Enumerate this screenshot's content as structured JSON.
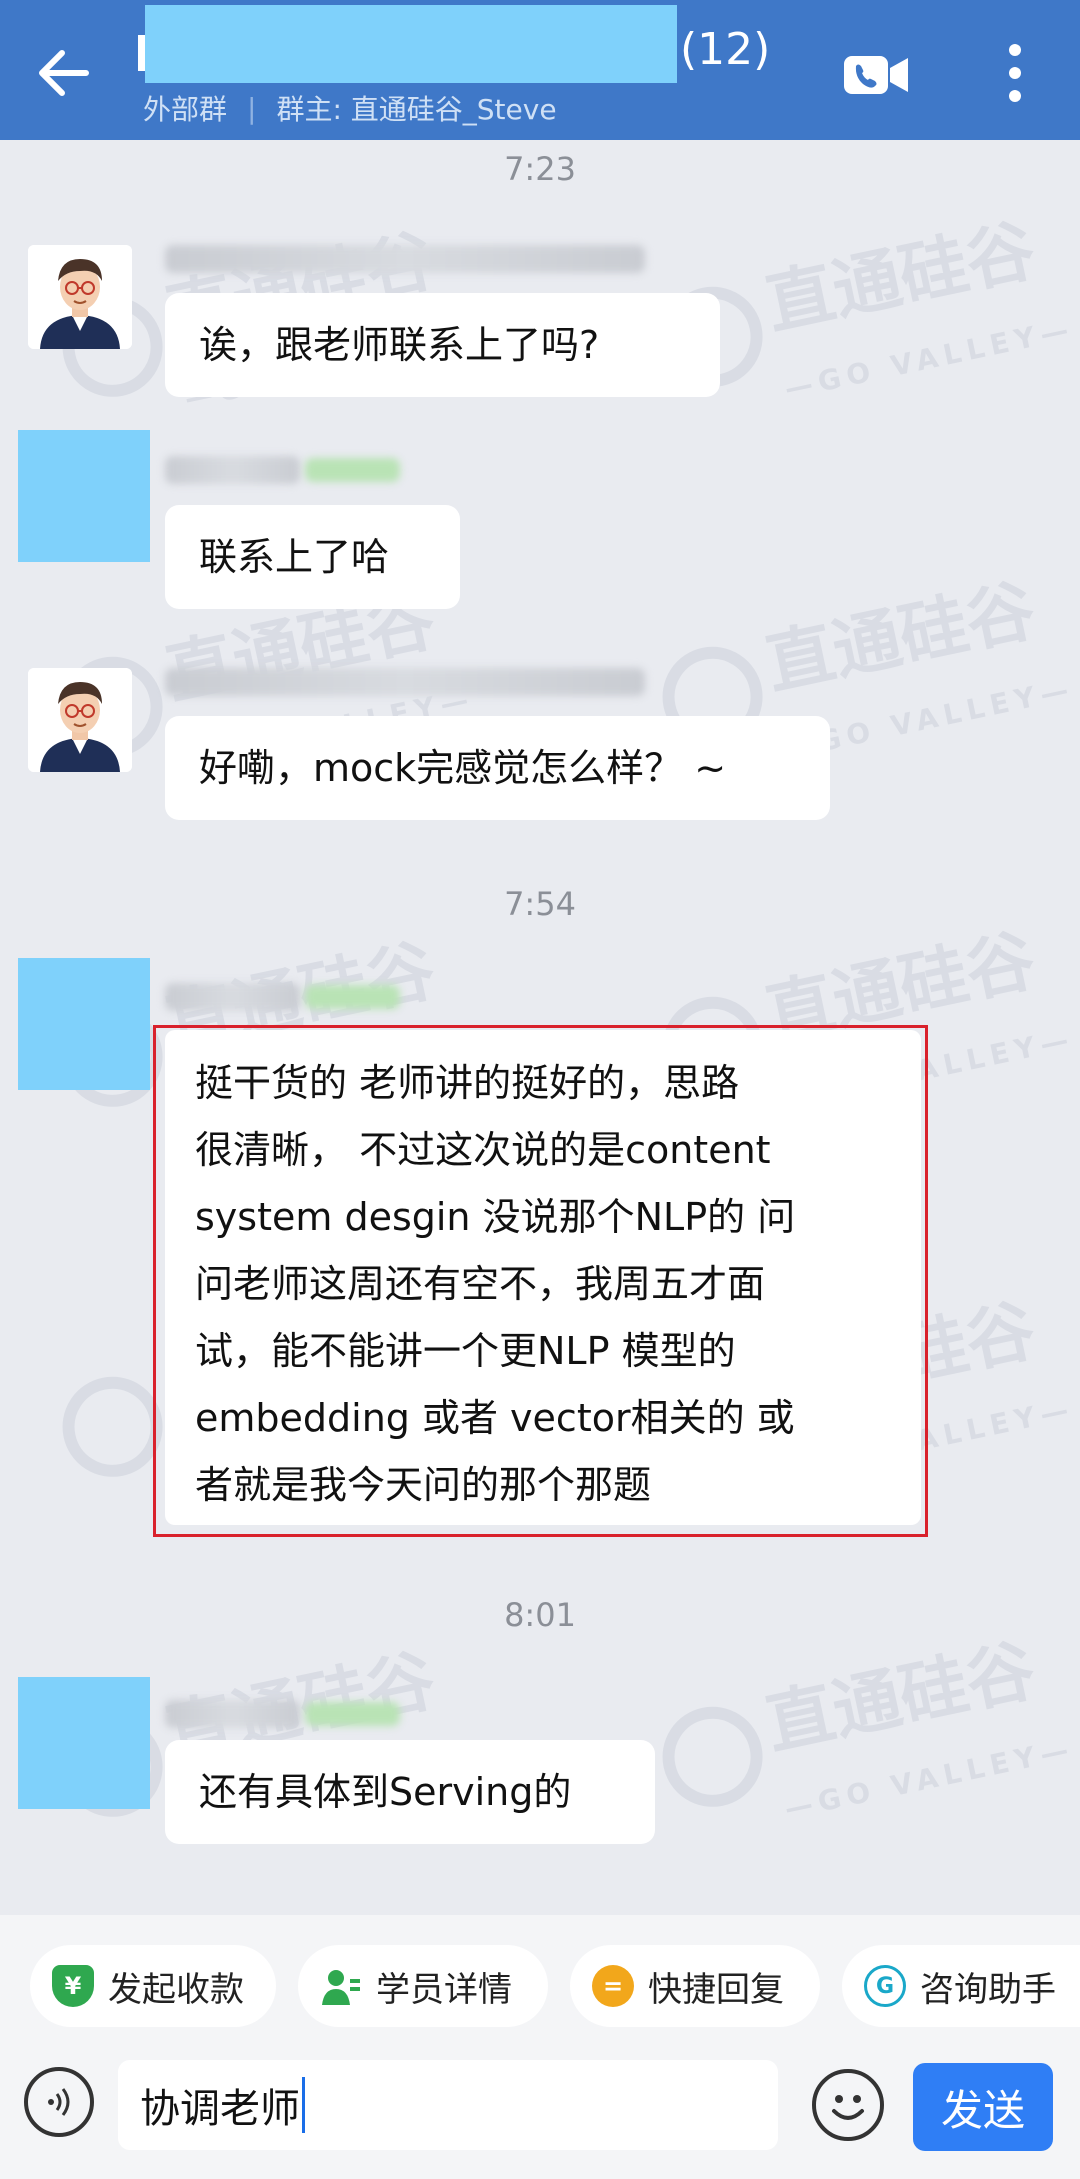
{
  "header": {
    "member_count": "(12)",
    "group_type": "外部群",
    "owner": "群主: 直通硅谷_Steve"
  },
  "watermark": {
    "brand": "直通硅谷",
    "sub": "—GO VALLEY—"
  },
  "messages": {
    "time_1": "7:23",
    "msg_1": "诶，跟老师联系上了吗?",
    "msg_2": "联系上了哈",
    "msg_3": "好嘞，mock完感觉怎么样？ ~",
    "time_2": "7:54",
    "msg_4_lines": [
      "挺干货的 老师讲的挺好的，思路",
      "很清晰， 不过这次说的是content",
      "system desgin 没说那个NLP的 问",
      "问老师这周还有空不，我周五才面",
      "试，能不能讲一个更NLP 模型的",
      "embedding 或者 vector相关的 或",
      "者就是我今天问的那个那题"
    ],
    "time_3": "8:01",
    "msg_5": "还有具体到Serving的"
  },
  "toolbar": {
    "chips": [
      {
        "label": "发起收款",
        "icon": "¥",
        "color": "#2fa84f"
      },
      {
        "label": "学员详情",
        "icon": "person",
        "color": "#2fa84f"
      },
      {
        "label": "快捷回复",
        "icon": "=",
        "color": "#f2a71b"
      },
      {
        "label": "咨询助手",
        "icon": "G",
        "color": "#1aa8c9"
      }
    ],
    "input_value": "协调老师",
    "send_label": "发送"
  }
}
